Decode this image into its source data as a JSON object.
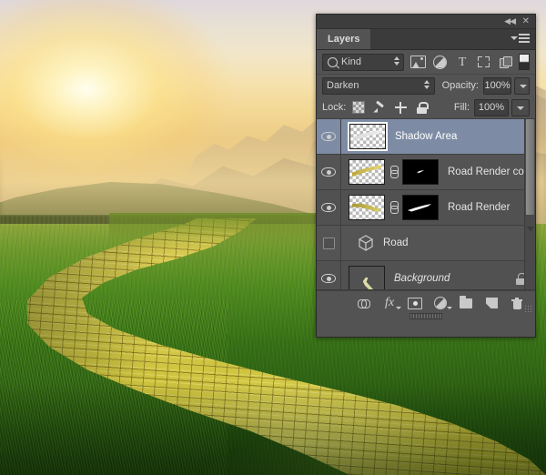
{
  "panel": {
    "titlebar": {
      "collapse_label": "◀◀",
      "close_label": "✕"
    },
    "tab_label": "Layers",
    "menu_icon": "panel-menu-icon",
    "filter": {
      "search_icon": "search-icon",
      "kind_value": "Kind",
      "icons": [
        {
          "name": "pixel-filter-icon",
          "label": "Pixel layers"
        },
        {
          "name": "adjustment-filter-icon",
          "label": "Adjustment layers"
        },
        {
          "name": "type-filter-icon",
          "label": "Type layers"
        },
        {
          "name": "shape-filter-icon",
          "label": "Shape layers"
        },
        {
          "name": "smart-object-filter-icon",
          "label": "Smart objects"
        }
      ],
      "toggle_label": "Filter toggle"
    },
    "blend": {
      "mode_value": "Darken",
      "opacity_label": "Opacity:",
      "opacity_value": "100%"
    },
    "lock": {
      "label": "Lock:",
      "icons": [
        {
          "name": "lock-transparent-pixels-icon"
        },
        {
          "name": "lock-image-pixels-icon"
        },
        {
          "name": "lock-position-icon"
        },
        {
          "name": "lock-all-icon"
        }
      ],
      "fill_label": "Fill:",
      "fill_value": "100%"
    },
    "layers": [
      {
        "name": "Shadow Area",
        "visible": true,
        "selected": true,
        "has_mask": false,
        "kind": "pixel",
        "locked": false,
        "italic": false
      },
      {
        "name": "Road Render copy",
        "visible": true,
        "selected": false,
        "has_mask": true,
        "kind": "pixel",
        "locked": false,
        "italic": false
      },
      {
        "name": "Road Render",
        "visible": true,
        "selected": false,
        "has_mask": true,
        "kind": "pixel",
        "locked": false,
        "italic": false
      },
      {
        "name": "Road",
        "visible": false,
        "selected": false,
        "has_mask": false,
        "kind": "3d",
        "locked": false,
        "italic": false
      },
      {
        "name": "Background",
        "visible": true,
        "selected": false,
        "has_mask": false,
        "kind": "photo",
        "locked": true,
        "italic": true
      }
    ],
    "scrollbar": {
      "name": "layers-vertical-scrollbar"
    },
    "footer_buttons": [
      {
        "name": "link-layers-button",
        "label": "Link layers"
      },
      {
        "name": "layer-style-button",
        "label": "Add a layer style"
      },
      {
        "name": "add-layer-mask-button",
        "label": "Add layer mask"
      },
      {
        "name": "new-adjustment-layer-button",
        "label": "New fill or adjustment layer"
      },
      {
        "name": "new-group-button",
        "label": "Create a new group"
      },
      {
        "name": "new-layer-button",
        "label": "Create a new layer"
      },
      {
        "name": "delete-layer-button",
        "label": "Delete layer"
      }
    ]
  },
  "canvas": {
    "description": "Sunset mountain landscape with winding yellow brick road through green meadow"
  },
  "colors": {
    "panel_bg": "#535353",
    "panel_header": "#3b3b3b",
    "layer_row": "#545454",
    "selected_row": "#7d8ca4",
    "text": "#e4e4e4",
    "icon": "#c9c9c9",
    "road_yellow": "#d4c84c",
    "meadow_green": "#356f14"
  }
}
